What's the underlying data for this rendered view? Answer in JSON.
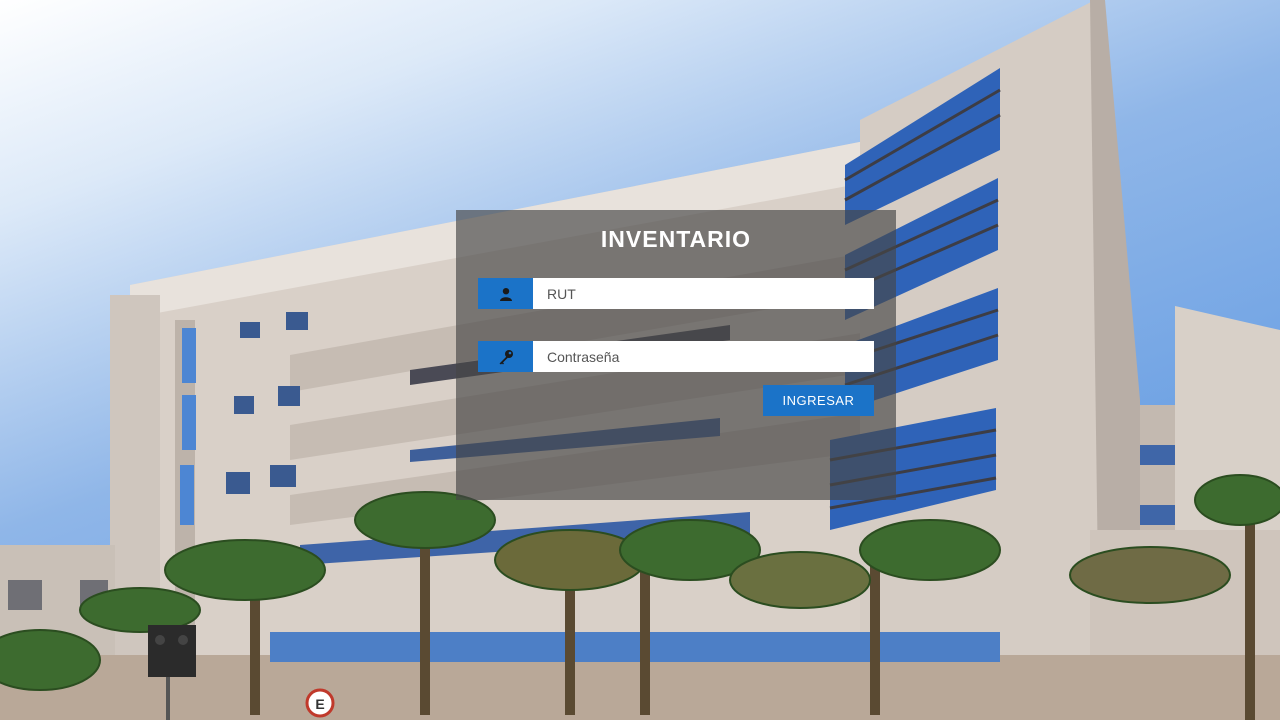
{
  "login": {
    "title": "INVENTARIO",
    "rut_placeholder": "RUT",
    "password_placeholder": "Contraseña",
    "submit_label": "INGRESAR"
  },
  "background": {
    "description_icon": "building-photo",
    "sign_text": "E"
  },
  "colors": {
    "accent": "#1b73c8",
    "panel": "rgba(70,70,70,0.66)",
    "sky_top": "#dce9f8",
    "sky_bottom": "#4f8fe0"
  },
  "icons": {
    "rut": "user-icon",
    "password": "key-icon"
  }
}
